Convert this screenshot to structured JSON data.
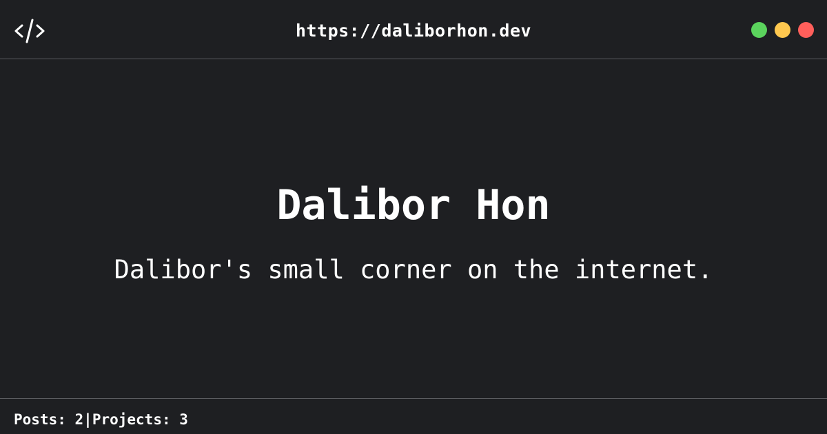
{
  "header": {
    "icon": "code-icon",
    "url": "https://daliborhon.dev",
    "window_controls": [
      {
        "name": "green-dot",
        "color": "#5bd35d"
      },
      {
        "name": "yellow-dot",
        "color": "#ffc84f"
      },
      {
        "name": "red-dot",
        "color": "#ff5f5b"
      }
    ]
  },
  "main": {
    "title": "Dalibor Hon",
    "subtitle": "Dalibor's small corner on the internet."
  },
  "footer": {
    "posts_label": "Posts: ",
    "posts_count": "2",
    "separator": "|",
    "projects_label": "Projects: ",
    "projects_count": "3"
  }
}
